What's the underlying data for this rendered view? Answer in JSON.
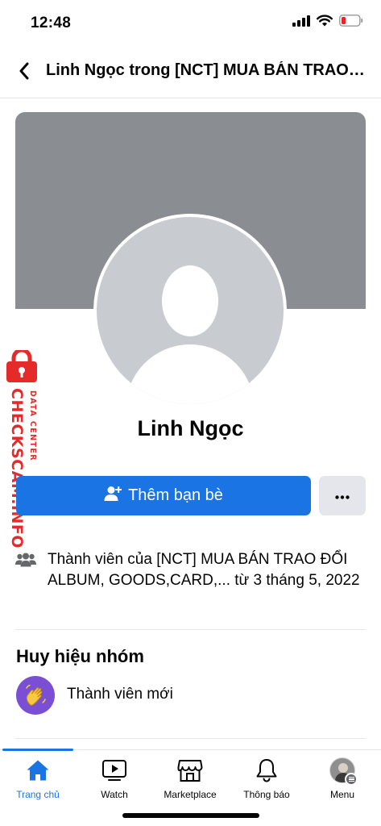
{
  "status_bar": {
    "time": "12:48",
    "signal_icon": "cellular-signal-icon",
    "wifi_icon": "wifi-icon",
    "battery_icon": "battery-low-icon",
    "battery_color": "#e5252a"
  },
  "header": {
    "back_icon": "chevron-left-icon",
    "title": "Linh Ngọc trong [NCT] MUA BÁN TRAO ĐỔI ALBUM, GOODS,CARD,..."
  },
  "profile": {
    "cover_color": "#8a8d91",
    "avatar": "default-avatar-icon",
    "name": "Linh Ngọc"
  },
  "watermark": {
    "main": "CHECKSCAM.INFO",
    "sub": "DATA CENTER",
    "color": "#e52a2a"
  },
  "actions": {
    "add_friend_label": "Thêm bạn bè",
    "add_friend_icon": "person-add-icon",
    "more_icon": "more-dots-icon",
    "primary_color": "#1b74e4"
  },
  "membership": {
    "icon": "group-members-icon",
    "text": "Thành viên của [NCT] MUA BÁN TRAO ĐỔI ALBUM, GOODS,CARD,... từ 3 tháng 5, 2022"
  },
  "badges": {
    "title": "Huy hiệu nhóm",
    "items": [
      {
        "label": "Thành viên mới",
        "icon": "waving-hand-icon",
        "color": "#7b4fd4"
      }
    ]
  },
  "tabbar": {
    "tabs": [
      {
        "label": "Trang chủ",
        "icon": "home-icon",
        "active": true
      },
      {
        "label": "Watch",
        "icon": "watch-video-icon",
        "active": false
      },
      {
        "label": "Marketplace",
        "icon": "marketplace-icon",
        "active": false
      },
      {
        "label": "Thông báo",
        "icon": "bell-icon",
        "active": false
      },
      {
        "label": "Menu",
        "icon": "menu-avatar-icon",
        "active": false
      }
    ]
  }
}
